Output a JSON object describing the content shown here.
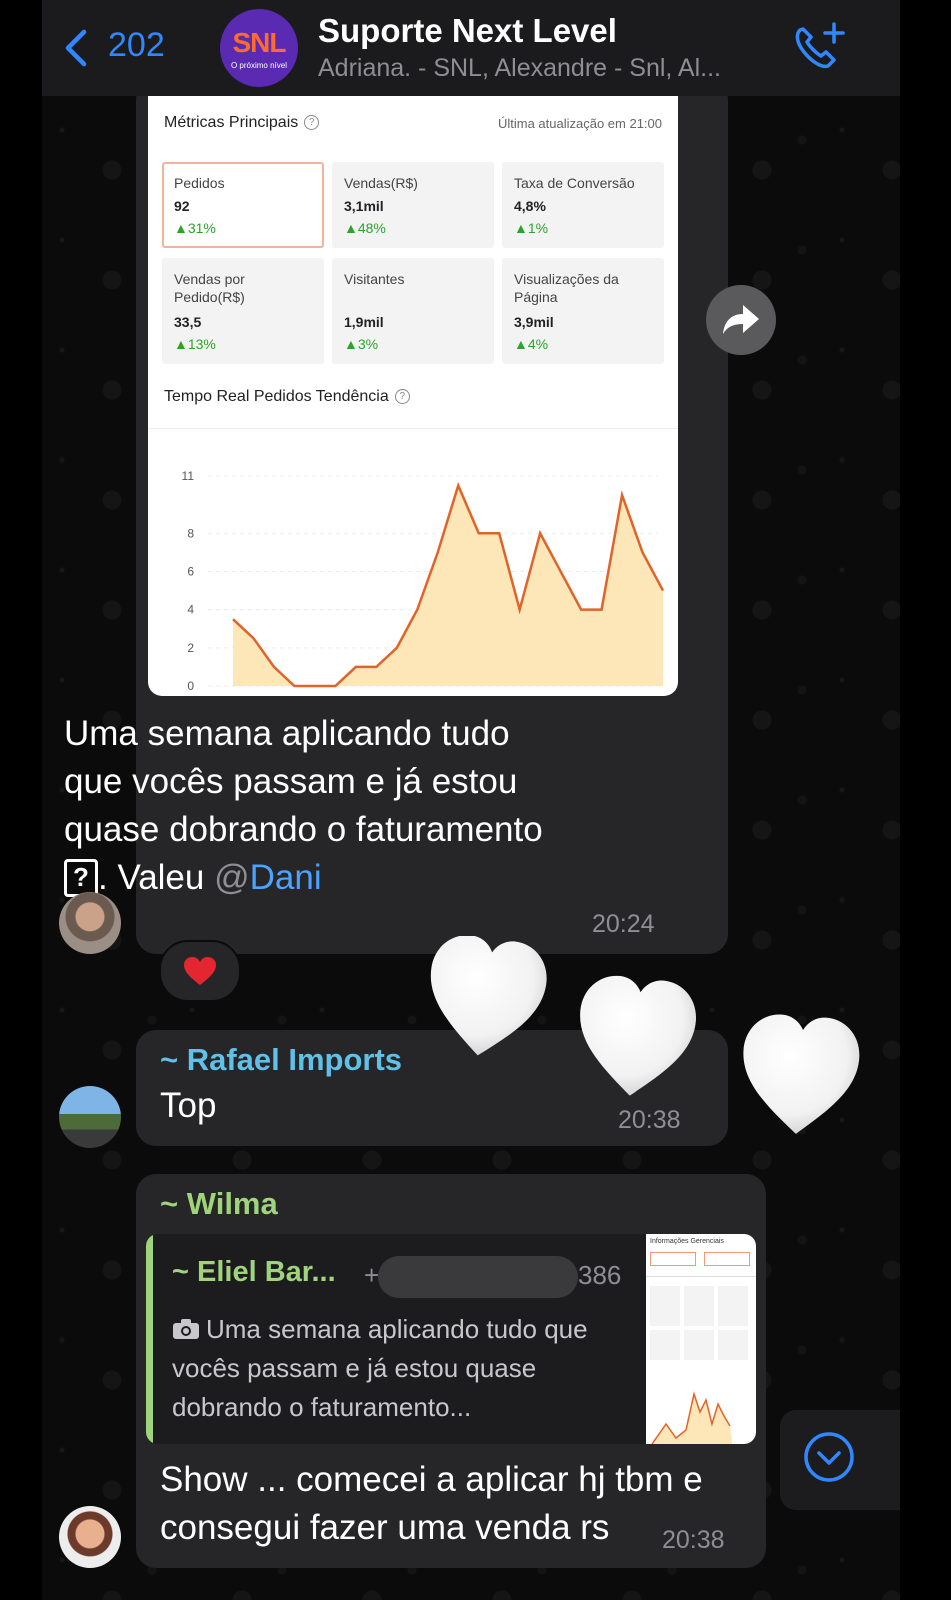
{
  "header": {
    "back_count": "202",
    "group_title": "Suporte Next Level",
    "members": "Adriana. - SNL, Alexandre - Snl, Al...",
    "logo_text": "SNL",
    "logo_sub": "O próximo nível"
  },
  "message1": {
    "card": {
      "metrics_title": "Métricas Principais",
      "updated": "Última atualização em 21:00",
      "metrics": [
        {
          "label": "Pedidos",
          "value": "92",
          "change": "▲31%"
        },
        {
          "label": "Vendas(R$)",
          "value": "3,1mil",
          "change": "▲48%"
        },
        {
          "label": "Taxa de Conversão",
          "value": "4,8%",
          "change": "▲1%"
        },
        {
          "label": "Vendas por Pedido(R$)",
          "value": "33,5",
          "change": "▲13%"
        },
        {
          "label": "Visitantes",
          "value": "1,9mil",
          "change": "▲3%"
        },
        {
          "label": "Visualizações da Página",
          "value": "3,9mil",
          "change": "▲4%"
        }
      ],
      "chart_title": "Tempo Real Pedidos Tendência"
    },
    "text_before": "Uma semana aplicando tudo que vocês passam e já estou quase dobrando o faturamento ",
    "glyph": "?",
    "text_after": ". Valeu ",
    "mention_at": "@",
    "mention_name": "Dani",
    "time": "20:24",
    "reaction": "❤️"
  },
  "message2": {
    "sender": "~ Rafael Imports",
    "text": "Top",
    "time": "20:38"
  },
  "message3": {
    "sender": "~ Wilma",
    "reply": {
      "sender": "~ Eliel Bar...",
      "phone_tail": "386",
      "text": "Uma semana aplicando tudo que vocês passam e já estou quase dobrando o faturamento...",
      "thumb_title": "Informações Gerenciais"
    },
    "text": "Show ... comecei a aplicar hj tbm e consegui fazer uma venda rs",
    "time": "20:38"
  },
  "colors": {
    "accent_blue": "#2f88ff",
    "mention_blue": "#4aa3ff",
    "rafael_name": "#5fc0e8",
    "wilma_name": "#9fd47d",
    "chart_line": "#e0642a",
    "chart_fill": "#fde6b8"
  },
  "chart_data": {
    "type": "area",
    "title": "Tempo Real Pedidos Tendência",
    "y_ticks": [
      "0",
      "2",
      "4",
      "6",
      "8",
      "11"
    ],
    "ylim": [
      0,
      11
    ],
    "x": [
      0,
      1,
      2,
      3,
      4,
      5,
      6,
      7,
      8,
      9,
      10,
      11,
      12,
      13,
      14,
      15,
      16,
      17,
      18,
      19,
      20,
      21,
      22,
      23
    ],
    "values": [
      null,
      null,
      null,
      null,
      null,
      3.5,
      2.5,
      1,
      0,
      0,
      0,
      1,
      1,
      2,
      4,
      7,
      10.5,
      8,
      8,
      4,
      8,
      6,
      4,
      4,
      10,
      7,
      5
    ],
    "grid": true
  }
}
